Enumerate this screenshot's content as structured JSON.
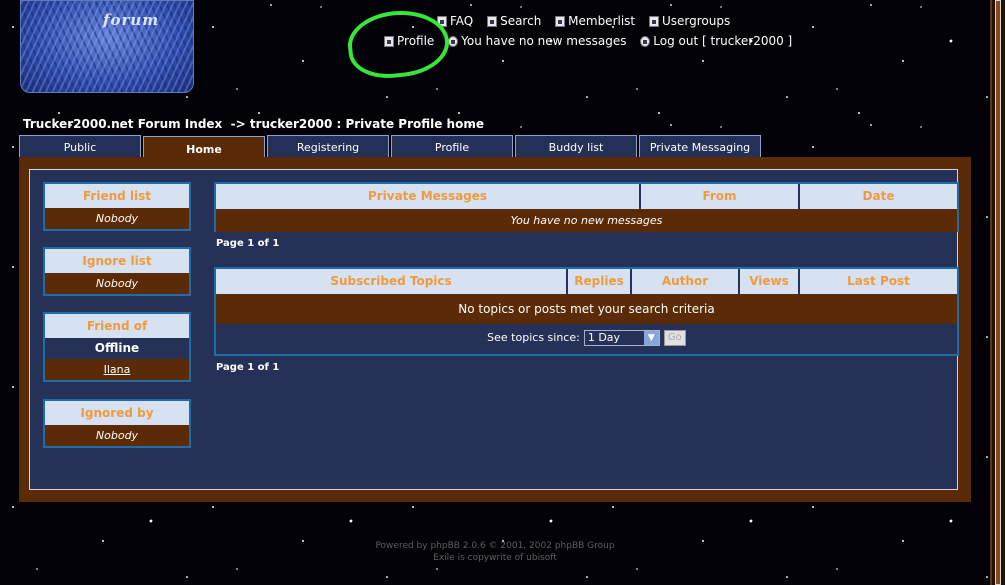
{
  "logo": {
    "text": "forum"
  },
  "topnav": {
    "row1": [
      {
        "label": "FAQ",
        "icon": "faq-icon"
      },
      {
        "label": "Search",
        "icon": "search-icon"
      },
      {
        "label": "Memberlist",
        "icon": "memberlist-icon"
      },
      {
        "label": "Usergroups",
        "icon": "usergroups-icon"
      }
    ],
    "row2": [
      {
        "label": "Profile",
        "icon": "profile-icon"
      },
      {
        "label": "You have no new messages",
        "icon": "messages-icon"
      },
      {
        "label": "Log out [ trucker2000 ]",
        "icon": "logout-icon"
      }
    ]
  },
  "breadcrumb": {
    "index": "Trucker2000.net Forum Index",
    "separator": "->",
    "current": "trucker2000 : Private Profile home"
  },
  "tabs": [
    "Public",
    "Home",
    "Registering",
    "Profile",
    "Buddy list",
    "Private Messaging"
  ],
  "active_tab": "Home",
  "sidebar": {
    "friend_list": {
      "title": "Friend list",
      "value": "Nobody"
    },
    "ignore_list": {
      "title": "Ignore list",
      "value": "Nobody"
    },
    "friend_of": {
      "title": "Friend of",
      "status": "Offline",
      "user": "Ilana"
    },
    "ignored_by": {
      "title": "Ignored by",
      "value": "Nobody"
    }
  },
  "pm_table": {
    "headers": [
      "Private Messages",
      "From",
      "Date"
    ],
    "empty_message": "You have no new messages",
    "pager": "Page 1 of 1"
  },
  "topics_table": {
    "headers": [
      "Subscribed Topics",
      "Replies",
      "Author",
      "Views",
      "Last Post"
    ],
    "empty_message": "No topics or posts met your search criteria",
    "since_label": "See topics since:",
    "since_value": "1 Day",
    "go_label": "Go",
    "pager": "Page 1 of 1"
  },
  "footer": {
    "line1": "Powered by phpBB 2.0.6 © 2001, 2002 phpBB Group",
    "line2": "Exile is copywrite of ubisoft"
  },
  "colors": {
    "panel_brown": "#5b2a06",
    "panel_navy": "#253157",
    "header_bg": "#d6e1f2",
    "header_text": "#f09a3c",
    "highlight_ring": "#37e63a"
  }
}
